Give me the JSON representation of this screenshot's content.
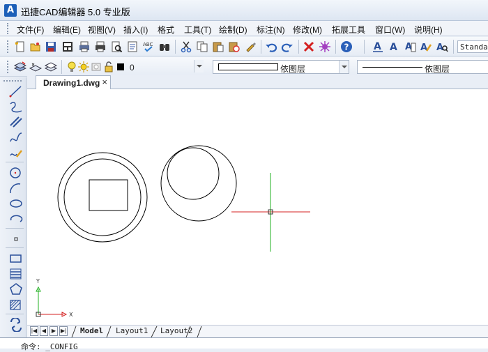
{
  "window": {
    "title": "迅捷CAD编辑器 5.0 专业版",
    "logo_text": "A"
  },
  "menu": [
    "文件(F)",
    "编辑(E)",
    "视图(V)",
    "插入(I)",
    "格式",
    "工具(T)",
    "绘制(D)",
    "标注(N)",
    "修改(M)",
    "拓展工具",
    "窗口(W)",
    "说明(H)"
  ],
  "toolbar": {
    "text_style": "Standard"
  },
  "properties": {
    "color_value": "0",
    "linetype": "依图层",
    "lineweight": "依图层"
  },
  "document_tab": {
    "name": "Drawing1.dwg",
    "close_glyph": "×"
  },
  "layouts": [
    "Model",
    "Layout1",
    "Layout2"
  ],
  "ucs": {
    "y_label": "Y",
    "x_label": "X"
  },
  "command_line": {
    "text": "命令: _CONFIG"
  },
  "colors": {
    "crosshair_h": "#d42020",
    "crosshair_v": "#20b020",
    "ucs_y": "#20b020",
    "ucs_x": "#d42020"
  }
}
